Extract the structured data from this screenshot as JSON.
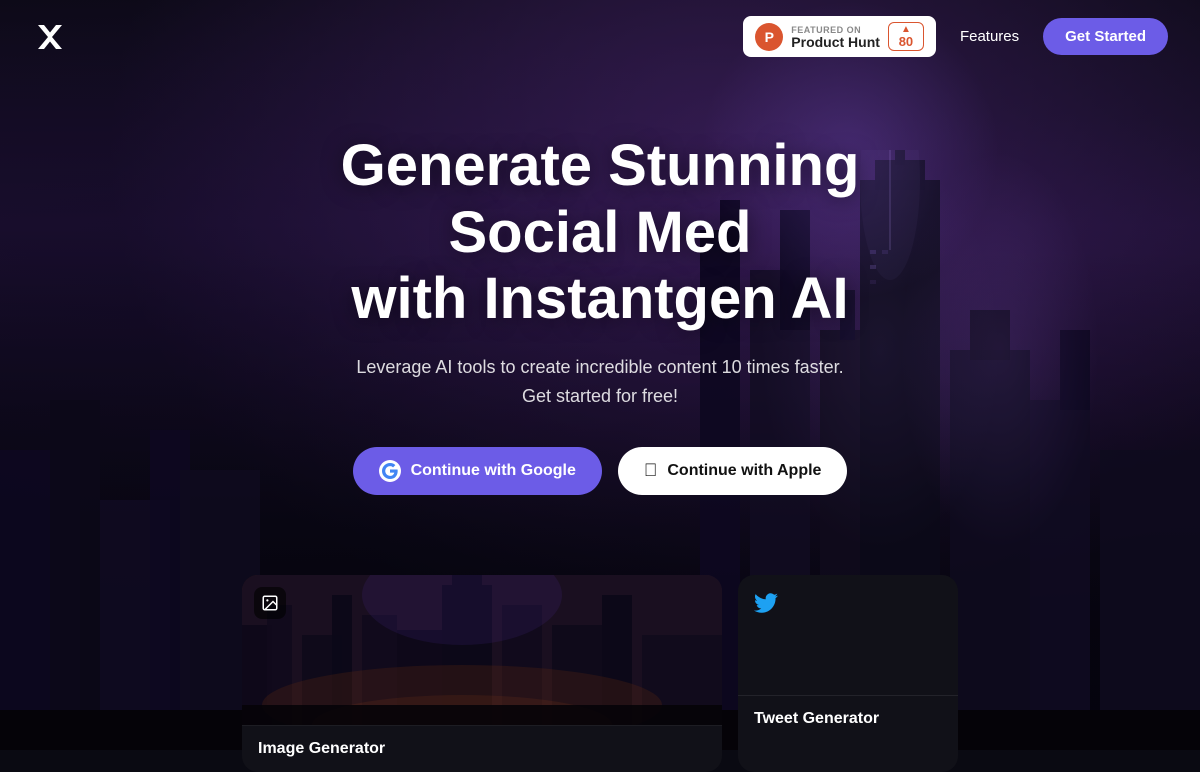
{
  "navbar": {
    "logo_text": "✕",
    "product_hunt": {
      "featured_label": "FEATURED ON",
      "name": "Product Hunt",
      "logo_letter": "P",
      "arrow": "▲",
      "vote_count": "80"
    },
    "features_label": "Features",
    "get_started_label": "Get Started"
  },
  "hero": {
    "title_line1": "Generate Stunning",
    "title_line2": "Social Med",
    "title_line3": "with Instantgen AI",
    "subtitle": "Leverage AI tools to create incredible content 10 times faster. Get started for free!",
    "btn_google": "Continue with Google",
    "btn_apple": "Continue with Apple"
  },
  "cards": [
    {
      "icon": "🖼",
      "title": "Image Generator"
    },
    {
      "icon": "🐦",
      "title": "Tweet Generator"
    }
  ],
  "colors": {
    "accent": "#6c5ce7",
    "ph_orange": "#da552f",
    "twitter_blue": "#1da1f2"
  }
}
